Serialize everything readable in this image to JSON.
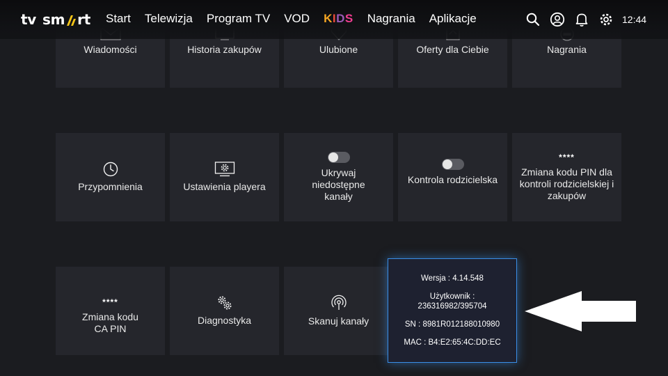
{
  "header": {
    "logo": {
      "left": "tv",
      "right1": "sm",
      "right2": "rt"
    },
    "nav": [
      "Start",
      "Telewizja",
      "Program TV",
      "VOD"
    ],
    "nav_kids": [
      "K",
      "I",
      "D",
      "S"
    ],
    "nav_after": [
      "Nagrania",
      "Aplikacje"
    ],
    "icons": [
      "search-icon",
      "profile-icon",
      "bell-icon",
      "settings-icon"
    ],
    "clock": "12:44"
  },
  "row1": [
    {
      "label": "Wiadomości",
      "icon": "envelope-icon"
    },
    {
      "label": "Historia zakupów",
      "icon": "monitor-icon"
    },
    {
      "label": "Ulubione",
      "icon": "heart-icon"
    },
    {
      "label": "Oferty dla Ciebie",
      "icon": "offer-icon"
    },
    {
      "label": "Nagrania",
      "icon": "rec-icon"
    }
  ],
  "row2": [
    {
      "label": "Przypomnienia",
      "icon": "clock-icon"
    },
    {
      "label": "Ustawienia playera",
      "icon": "player-settings-icon"
    },
    {
      "label": "Ukrywaj niedostępne kanały",
      "toggle_on": false
    },
    {
      "label": "Kontrola rodzicielska",
      "toggle_on": false
    },
    {
      "label": "Zmiana kodu PIN dla kontroli rodzicielskiej i zakupów",
      "stars": "****"
    }
  ],
  "row3": [
    {
      "label": "Zmiana kodu CA PIN",
      "stars": "****"
    },
    {
      "label": "Diagnostyka",
      "icon": "gears-icon"
    },
    {
      "label": "Skanuj kanały",
      "icon": "scan-icon"
    }
  ],
  "info": {
    "version": "Wersja : 4.14.548",
    "user_label": "Użytkownik :",
    "user_value": "236316982/395704",
    "sn": "SN : 8981R012188010980",
    "mac": "MAC : B4:E2:65:4C:DD:EC"
  },
  "colors": {
    "accent": "#3a8fe8",
    "logo_mark": "#f5c518",
    "background": "#1b1c20",
    "tile": "#25262c"
  }
}
